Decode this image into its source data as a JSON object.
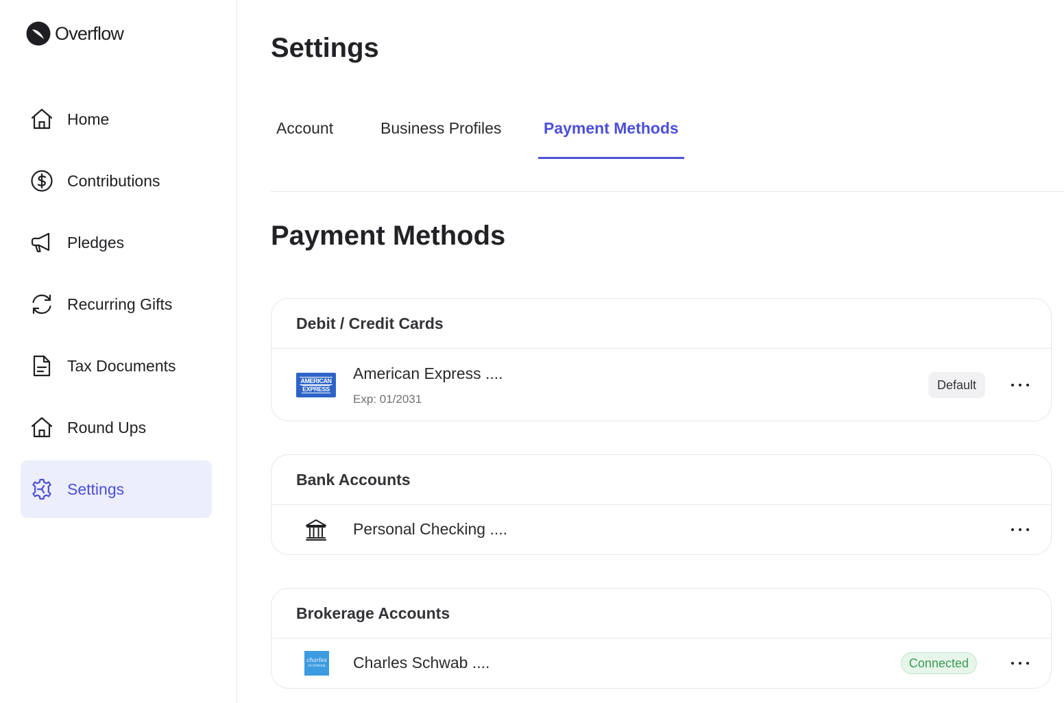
{
  "app": {
    "name": "Overflow"
  },
  "sidebar": {
    "items": [
      {
        "label": "Home",
        "icon": "home-icon",
        "active": false
      },
      {
        "label": "Contributions",
        "icon": "dollar-circle-icon",
        "active": false
      },
      {
        "label": "Pledges",
        "icon": "megaphone-icon",
        "active": false
      },
      {
        "label": "Recurring Gifts",
        "icon": "refresh-icon",
        "active": false
      },
      {
        "label": "Tax Documents",
        "icon": "document-icon",
        "active": false
      },
      {
        "label": "Round Ups",
        "icon": "home-icon",
        "active": false
      },
      {
        "label": "Settings",
        "icon": "gear-icon",
        "active": true
      }
    ]
  },
  "main": {
    "title": "Settings",
    "tabs": [
      {
        "label": "Account",
        "active": false
      },
      {
        "label": "Business Profiles",
        "active": false
      },
      {
        "label": "Payment Methods",
        "active": true
      }
    ],
    "section_title": "Payment Methods",
    "cards": [
      {
        "title": "Debit / Credit Cards",
        "rows": [
          {
            "icon": "american-express-logo",
            "logo_lines": [
              "AMERICAN",
              "EXPRESS"
            ],
            "name": "American Express ....",
            "sub": "Exp: 01/2031",
            "badge": "Default"
          }
        ]
      },
      {
        "title": "Bank Accounts",
        "rows": [
          {
            "icon": "bank-icon",
            "name": "Personal Checking ...."
          }
        ]
      },
      {
        "title": "Brokerage Accounts",
        "rows": [
          {
            "icon": "charles-schwab-logo",
            "logo_lines": [
              "charles",
              "SCHWAB"
            ],
            "name": "Charles Schwab ....",
            "badge": "Connected"
          }
        ]
      }
    ]
  },
  "colors": {
    "accent": "#4b4fd8",
    "active_nav_bg": "#eceefb",
    "connected_green": "#3c9a55",
    "amex_blue": "#2e64c8",
    "schwab_blue": "#3d9be0"
  }
}
